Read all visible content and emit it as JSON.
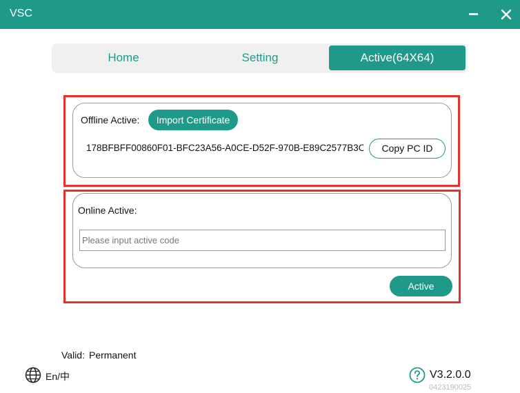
{
  "window": {
    "title": "VSC"
  },
  "tabs": [
    {
      "label": "Home"
    },
    {
      "label": "Setting"
    },
    {
      "label": "Active(64X64)"
    }
  ],
  "offline": {
    "label": "Offline Active:",
    "import_button": "Import Certificate",
    "pc_id": "178BFBFF00860F01-BFC23A56-A0CE-D52F-970B-E89C2577B3C",
    "copy_button": "Copy PC ID"
  },
  "online": {
    "label": "Online Active:",
    "input_value": "",
    "input_placeholder": "Please input active code",
    "active_button": "Active"
  },
  "status": {
    "valid_label": "Valid:",
    "valid_value": "Permanent"
  },
  "footer": {
    "language": "En/中",
    "version": "V3.2.0.0",
    "build": "0423190025",
    "icons": {
      "language": "globe-icon",
      "help": "help-icon"
    }
  },
  "colors": {
    "accent": "#1f9a8a",
    "highlight": "#e8312b"
  }
}
